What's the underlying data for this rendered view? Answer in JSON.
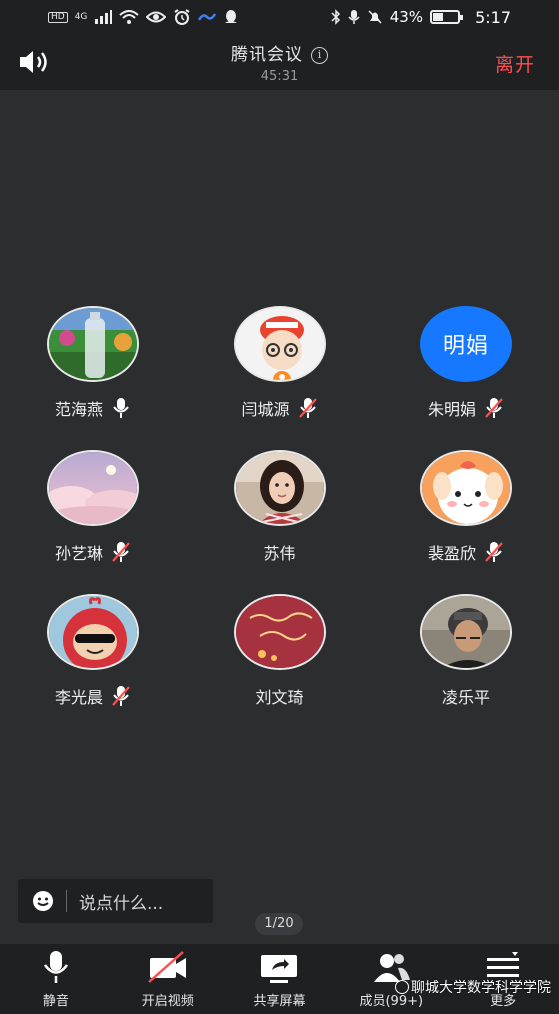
{
  "status_bar": {
    "hd": "HD",
    "network": "4G",
    "battery": "43%",
    "time": "5:17"
  },
  "header": {
    "title": "腾讯会议",
    "timer": "45:31",
    "leave": "离开"
  },
  "participants": [
    {
      "name": "范海燕",
      "mic": "on",
      "avatar": "photo-bottle"
    },
    {
      "name": "闫城源",
      "mic": "muted",
      "avatar": "cartoon-boy-red-hat"
    },
    {
      "name": "朱明娟",
      "mic": "muted",
      "avatar": "text",
      "avatar_text": "明娟",
      "avatar_color": "#1677ff"
    },
    {
      "name": "孙艺琳",
      "mic": "muted",
      "avatar": "photo-pink-sky"
    },
    {
      "name": "苏伟",
      "mic": "none",
      "avatar": "photo-girl"
    },
    {
      "name": "裴盈欣",
      "mic": "muted",
      "avatar": "cartoon-white-dog"
    },
    {
      "name": "李光晨",
      "mic": "muted",
      "avatar": "cartoon-teletubby"
    },
    {
      "name": "刘文琦",
      "mic": "none",
      "avatar": "text-sticker"
    },
    {
      "name": "凌乐平",
      "mic": "none",
      "avatar": "photo-helmet"
    }
  ],
  "chat": {
    "placeholder": "说点什么..."
  },
  "page_indicator": "1/20",
  "toolbar": {
    "mute": "静音",
    "video": "开启视频",
    "share": "共享屏幕",
    "members": "成员(99+)",
    "more": "更多"
  },
  "watermark": "聊城大学数学科学学院",
  "colors": {
    "accent": "#1677ff",
    "leave": "#ff4d4f",
    "background": "#2b2d2f",
    "bar": "#1f2022"
  }
}
